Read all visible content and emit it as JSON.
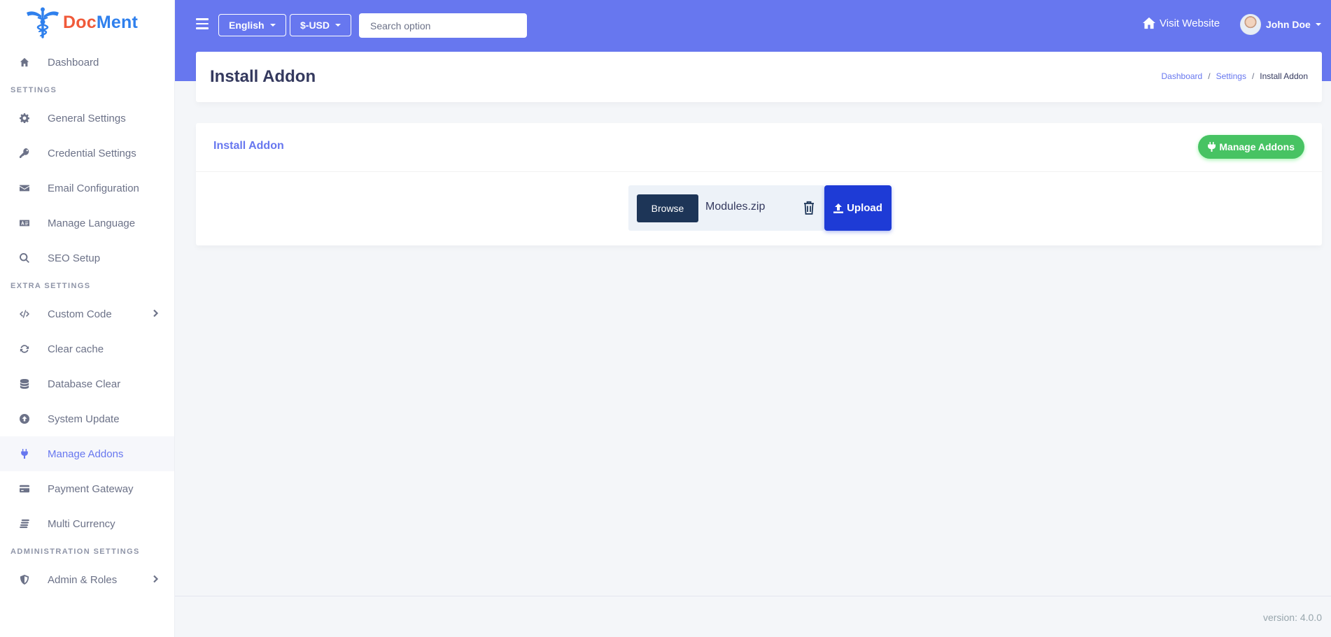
{
  "brand": {
    "doc": "Doc",
    "ment": "Ment",
    "icon": "caduceus-icon"
  },
  "sidebar": {
    "items": [
      {
        "type": "item",
        "label": "Dashboard",
        "icon": "home-icon"
      },
      {
        "type": "header",
        "label": "SETTINGS"
      },
      {
        "type": "item",
        "label": "General Settings",
        "icon": "gear-icon"
      },
      {
        "type": "item",
        "label": "Credential Settings",
        "icon": "key-icon"
      },
      {
        "type": "item",
        "label": "Email Configuration",
        "icon": "envelope-icon"
      },
      {
        "type": "item",
        "label": "Manage Language",
        "icon": "language-icon"
      },
      {
        "type": "item",
        "label": "SEO Setup",
        "icon": "search-icon"
      },
      {
        "type": "header",
        "label": "EXTRA SETTINGS"
      },
      {
        "type": "item",
        "label": "Custom Code",
        "icon": "code-icon",
        "chevron": true
      },
      {
        "type": "item",
        "label": "Clear cache",
        "icon": "sync-icon"
      },
      {
        "type": "item",
        "label": "Database Clear",
        "icon": "database-icon"
      },
      {
        "type": "item",
        "label": "System Update",
        "icon": "upload-circle-icon"
      },
      {
        "type": "item",
        "label": "Manage Addons",
        "icon": "plug-icon",
        "active": true
      },
      {
        "type": "item",
        "label": "Payment Gateway",
        "icon": "credit-card-icon"
      },
      {
        "type": "item",
        "label": "Multi Currency",
        "icon": "coins-icon"
      },
      {
        "type": "header",
        "label": "ADMINISTRATION SETTINGS"
      },
      {
        "type": "item",
        "label": "Admin & Roles",
        "icon": "shield-icon",
        "chevron": true
      }
    ]
  },
  "navbar": {
    "language": "English",
    "currency": "$-USD",
    "search_placeholder": "Search option",
    "visit_website": "Visit Website",
    "user_name": "John Doe"
  },
  "page": {
    "title": "Install Addon",
    "breadcrumb": {
      "home": "Dashboard",
      "settings": "Settings",
      "current": "Install Addon"
    }
  },
  "card": {
    "title": "Install Addon",
    "manage_button": "Manage Addons",
    "browse": "Browse",
    "file_name": "Modules.zip",
    "upload": "Upload"
  },
  "footer": {
    "version": "version: 4.0.0"
  },
  "colors": {
    "primary": "#6777ef",
    "success": "#47c363",
    "upload": "#1e3bd6",
    "browse": "#1d3557"
  }
}
